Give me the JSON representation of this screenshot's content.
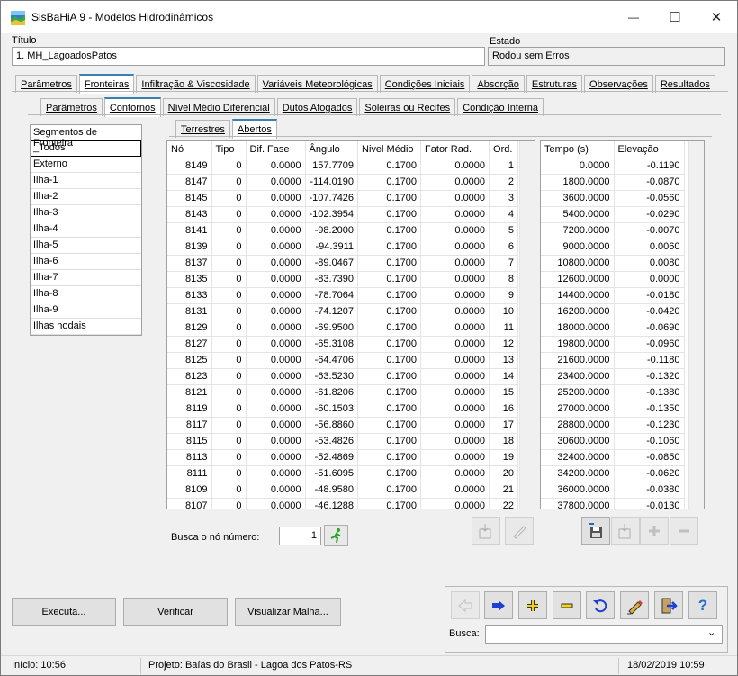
{
  "window": {
    "title": "SisBaHiA 9 - Modelos Hidrodinâmicos",
    "minimize": "—",
    "maximize": "☐",
    "close": "✕"
  },
  "header": {
    "titulo_label": "Título",
    "titulo_value": "1. MH_LagoadosPatos",
    "estado_label": "Estado",
    "estado_value": "Rodou sem Erros"
  },
  "main_tabs": [
    "Parâmetros",
    "Fronteiras",
    "Infiltração & Viscosidade",
    "Variáveis Meteorológicas",
    "Condições Iniciais",
    "Absorção",
    "Estruturas",
    "Observações",
    "Resultados"
  ],
  "sub_tabs": [
    "Parâmetros",
    "Contornos",
    "Nível Médio Diferencial",
    "Dutos Afogados",
    "Soleiras ou Recifes",
    "Condição Interna"
  ],
  "inner_tabs": [
    "Terrestres",
    "Abertos"
  ],
  "segments": {
    "header": "Segmentos de Fronteira",
    "items": [
      "_Todos",
      "Externo",
      "Ilha-1",
      "Ilha-2",
      "Ilha-3",
      "Ilha-4",
      "Ilha-5",
      "Ilha-6",
      "Ilha-7",
      "Ilha-8",
      "Ilha-9",
      "Ilhas nodais"
    ]
  },
  "nodes_table": {
    "columns": [
      "Nó",
      "Tipo",
      "Dif. Fase",
      "Ângulo",
      "Nivel Médio",
      "Fator Rad.",
      "Ord."
    ],
    "rows": [
      [
        "8149",
        "0",
        "0.0000",
        "157.7709",
        "0.1700",
        "0.0000",
        "1"
      ],
      [
        "8147",
        "0",
        "0.0000",
        "-114.0190",
        "0.1700",
        "0.0000",
        "2"
      ],
      [
        "8145",
        "0",
        "0.0000",
        "-107.7426",
        "0.1700",
        "0.0000",
        "3"
      ],
      [
        "8143",
        "0",
        "0.0000",
        "-102.3954",
        "0.1700",
        "0.0000",
        "4"
      ],
      [
        "8141",
        "0",
        "0.0000",
        "-98.2000",
        "0.1700",
        "0.0000",
        "5"
      ],
      [
        "8139",
        "0",
        "0.0000",
        "-94.3911",
        "0.1700",
        "0.0000",
        "6"
      ],
      [
        "8137",
        "0",
        "0.0000",
        "-89.0467",
        "0.1700",
        "0.0000",
        "7"
      ],
      [
        "8135",
        "0",
        "0.0000",
        "-83.7390",
        "0.1700",
        "0.0000",
        "8"
      ],
      [
        "8133",
        "0",
        "0.0000",
        "-78.7064",
        "0.1700",
        "0.0000",
        "9"
      ],
      [
        "8131",
        "0",
        "0.0000",
        "-74.1207",
        "0.1700",
        "0.0000",
        "10"
      ],
      [
        "8129",
        "0",
        "0.0000",
        "-69.9500",
        "0.1700",
        "0.0000",
        "11"
      ],
      [
        "8127",
        "0",
        "0.0000",
        "-65.3108",
        "0.1700",
        "0.0000",
        "12"
      ],
      [
        "8125",
        "0",
        "0.0000",
        "-64.4706",
        "0.1700",
        "0.0000",
        "13"
      ],
      [
        "8123",
        "0",
        "0.0000",
        "-63.5230",
        "0.1700",
        "0.0000",
        "14"
      ],
      [
        "8121",
        "0",
        "0.0000",
        "-61.8206",
        "0.1700",
        "0.0000",
        "15"
      ],
      [
        "8119",
        "0",
        "0.0000",
        "-60.1503",
        "0.1700",
        "0.0000",
        "16"
      ],
      [
        "8117",
        "0",
        "0.0000",
        "-56.8860",
        "0.1700",
        "0.0000",
        "17"
      ],
      [
        "8115",
        "0",
        "0.0000",
        "-53.4826",
        "0.1700",
        "0.0000",
        "18"
      ],
      [
        "8113",
        "0",
        "0.0000",
        "-52.4869",
        "0.1700",
        "0.0000",
        "19"
      ],
      [
        "8111",
        "0",
        "0.0000",
        "-51.6095",
        "0.1700",
        "0.0000",
        "20"
      ],
      [
        "8109",
        "0",
        "0.0000",
        "-48.9580",
        "0.1700",
        "0.0000",
        "21"
      ],
      [
        "8107",
        "0",
        "0.0000",
        "-46.1288",
        "0.1700",
        "0.0000",
        "22"
      ]
    ]
  },
  "time_table": {
    "columns": [
      "Tempo (s)",
      "Elevação"
    ],
    "rows": [
      [
        "0.0000",
        "-0.1190"
      ],
      [
        "1800.0000",
        "-0.0870"
      ],
      [
        "3600.0000",
        "-0.0560"
      ],
      [
        "5400.0000",
        "-0.0290"
      ],
      [
        "7200.0000",
        "-0.0070"
      ],
      [
        "9000.0000",
        "0.0060"
      ],
      [
        "10800.0000",
        "0.0080"
      ],
      [
        "12600.0000",
        "0.0000"
      ],
      [
        "14400.0000",
        "-0.0180"
      ],
      [
        "16200.0000",
        "-0.0420"
      ],
      [
        "18000.0000",
        "-0.0690"
      ],
      [
        "19800.0000",
        "-0.0960"
      ],
      [
        "21600.0000",
        "-0.1180"
      ],
      [
        "23400.0000",
        "-0.1320"
      ],
      [
        "25200.0000",
        "-0.1380"
      ],
      [
        "27000.0000",
        "-0.1350"
      ],
      [
        "28800.0000",
        "-0.1230"
      ],
      [
        "30600.0000",
        "-0.1060"
      ],
      [
        "32400.0000",
        "-0.0850"
      ],
      [
        "34200.0000",
        "-0.0620"
      ],
      [
        "36000.0000",
        "-0.0380"
      ],
      [
        "37800.0000",
        "-0.0130"
      ]
    ]
  },
  "search_node": {
    "label": "Busca o nó número:",
    "value": "1"
  },
  "buttons": {
    "executa": "Executa...",
    "verificar": "Verificar",
    "visualizar": "Visualizar Malha..."
  },
  "busca": {
    "label": "Busca:",
    "value": ""
  },
  "status": {
    "inicio": "Início: 10:56",
    "projeto": "Projeto: Baías do Brasil - Lagoa dos Patos-RS",
    "data": "18/02/2019 10:59"
  },
  "colors": {
    "accent": "#3c7fb1",
    "toolbar_blue": "#1f3fd0",
    "plus_yellow": "#f2d21a",
    "help_blue": "#1f6fd0",
    "run_green": "#2aa52a"
  }
}
